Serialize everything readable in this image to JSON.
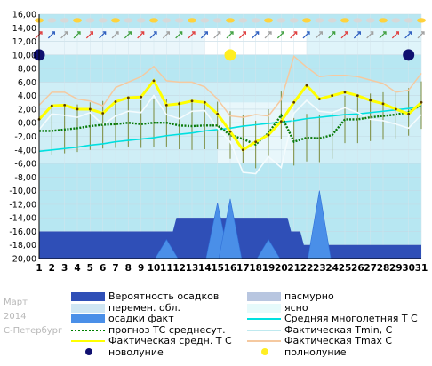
{
  "chart_data": {
    "type": "line",
    "ylim": [
      -20,
      16
    ],
    "yticks": [
      "16,00",
      "14,00",
      "12,00",
      "10,00",
      "8,00",
      "6,00",
      "4,00",
      "2,00",
      "0,00",
      "-2,00",
      "-4,00",
      "-6,00",
      "-8,00",
      "-10,00",
      "-12,00",
      "-14,00",
      "-16,00",
      "-18,00",
      "-20,00"
    ],
    "days": [
      "1",
      "2",
      "3",
      "4",
      "5",
      "6",
      "7",
      "8",
      "9",
      "10",
      "11",
      "12",
      "13",
      "14",
      "15",
      "16",
      "17",
      "18",
      "19",
      "20",
      "21",
      "22",
      "23",
      "24",
      "25",
      "26",
      "27",
      "28",
      "29",
      "30",
      "31"
    ],
    "series": [
      {
        "name": "Фактическая средн. Т С",
        "color": "#ffff00",
        "values": [
          0.5,
          2.5,
          2.6,
          2.0,
          2.0,
          1.4,
          3.1,
          3.7,
          3.8,
          6.2,
          2.6,
          2.8,
          3.2,
          3.0,
          1.3,
          -1.3,
          -4.0,
          -2.8,
          -1.8,
          0.2,
          3.0,
          5.5,
          3.5,
          4.0,
          4.5,
          4.0,
          3.3,
          2.8,
          2.0,
          1.3,
          3.0
        ]
      },
      {
        "name": "Фактическая Tmax, С",
        "color": "#f5c9a0",
        "values": [
          2.6,
          4.5,
          4.5,
          3.5,
          3.2,
          2.5,
          5.2,
          6.0,
          6.8,
          8.3,
          6.2,
          6.0,
          6.0,
          5.3,
          3.5,
          1.0,
          0.8,
          1.2,
          1.0,
          3.4,
          9.8,
          8.2,
          6.8,
          7.0,
          7.0,
          6.8,
          6.3,
          5.8,
          4.5,
          4.8,
          7.3
        ]
      },
      {
        "name": "Фактическая Tmin, С",
        "color": "#cfeff5",
        "values": [
          -1.0,
          1.3,
          1.1,
          0.8,
          1.5,
          -0.3,
          1.0,
          1.7,
          1.5,
          4.0,
          1.2,
          0.6,
          1.7,
          1.8,
          -0.8,
          -2.8,
          -7.3,
          -7.5,
          -5.0,
          -6.6,
          1.4,
          3.3,
          1.7,
          1.5,
          2.2,
          1.5,
          0.5,
          0.3,
          -0.2,
          -0.8,
          1.2
        ]
      },
      {
        "name": "прогноз ТС среднесут.",
        "color": "#008000",
        "values": [
          -1.2,
          -1.2,
          -1.0,
          -0.8,
          -0.5,
          -0.3,
          -0.2,
          0.0,
          -0.2,
          0.0,
          0.0,
          -0.4,
          -0.5,
          -0.4,
          -0.4,
          -1.8,
          -2.4,
          -3.2,
          -1.5,
          1.1,
          -2.8,
          -2.2,
          -2.3,
          -1.8,
          0.5,
          0.5,
          0.8,
          1.0,
          1.2,
          1.6,
          2.6
        ]
      },
      {
        "name": "Средняя многолетняя Т С",
        "color": "#00e0e0",
        "values": [
          -4.2,
          -4.0,
          -3.8,
          -3.6,
          -3.3,
          -3.1,
          -2.8,
          -2.6,
          -2.4,
          -2.2,
          -1.9,
          -1.7,
          -1.5,
          -1.2,
          -1.0,
          -0.8,
          -0.5,
          -0.3,
          -0.1,
          0.1,
          0.3,
          0.6,
          0.8,
          1.0,
          1.2,
          1.3,
          1.5,
          1.7,
          1.9,
          2.1,
          2.4
        ]
      },
      {
        "name": "Вероятность осадков",
        "color": "#3355cc",
        "values": [
          -16,
          -16,
          -16,
          -16,
          -16,
          -16,
          -16,
          -16,
          -16,
          -16,
          -16,
          -14,
          -14,
          -14,
          -14,
          -14,
          -14,
          -14,
          -14,
          -14,
          -16,
          -18,
          -18,
          -18,
          -18,
          -18,
          -18,
          -18,
          -18,
          -18,
          -18
        ]
      }
    ],
    "precip_fact": [
      {
        "day": 11,
        "peak": -17.2
      },
      {
        "day": 15,
        "peak": -11.8
      },
      {
        "day": 16,
        "peak": -11.2
      },
      {
        "day": 19,
        "peak": -17.2
      },
      {
        "day": 23,
        "peak": -10.0
      }
    ],
    "new_moon_days": [
      1,
      30
    ],
    "full_moon_days": [
      16
    ]
  },
  "side_labels": {
    "month": "Март",
    "year": "2014",
    "city": "С-Петербург"
  },
  "legend": [
    {
      "label": "Вероятность осадков",
      "color": "#2f4fb7",
      "kind": "box"
    },
    {
      "label": "пасмурно",
      "color": "#b8c6e0",
      "kind": "box"
    },
    {
      "label": "перемен. обл.",
      "color": "#cfe6f3",
      "kind": "box"
    },
    {
      "label": "ясно",
      "color": "#e6fafb",
      "kind": "box"
    },
    {
      "label": "осадки факт",
      "color": "#4a8fe8",
      "kind": "box"
    },
    {
      "label": "Средняя многолетняя Т С",
      "color": "#00e0e0",
      "kind": "line"
    },
    {
      "label": "прогноз ТС среднесут.",
      "color": "#008000",
      "kind": "dotted"
    },
    {
      "label": "Фактическая Tmin, С",
      "color": "#bfe9ef",
      "kind": "line"
    },
    {
      "label": "Фактическая средн. Т С",
      "color": "#ffff00",
      "kind": "line"
    },
    {
      "label": "Фактическая Tmax С",
      "color": "#f5c9a0",
      "kind": "line"
    },
    {
      "label": "новолуние",
      "color": "#101070",
      "kind": "dot"
    },
    {
      "label": "полнолуние",
      "color": "#ffee22",
      "kind": "dot"
    }
  ]
}
